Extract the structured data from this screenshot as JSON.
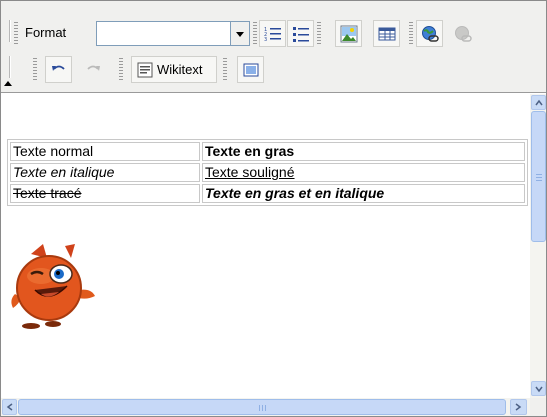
{
  "toolbar": {
    "format_label": "Format",
    "format_select_value": "",
    "wikitext_label": "Wikitext",
    "icons": {
      "ordered_list": "ordered-list-icon",
      "unordered_list": "unordered-list-icon",
      "image": "image-icon",
      "table": "table-icon",
      "link": "link-icon",
      "unlink": "unlink-icon",
      "undo": "undo-icon",
      "redo": "redo-icon",
      "wikitext": "wikitext-icon",
      "fullscreen": "fullscreen-icon"
    }
  },
  "content": {
    "table": {
      "rows": [
        [
          "Texte normal",
          "Texte en gras"
        ],
        [
          "Texte en italique",
          "Texte souligné"
        ],
        [
          "Texte tracé",
          "Texte en gras et en italique"
        ]
      ]
    },
    "image": "orange-mascot-emoticon"
  },
  "colors": {
    "toolbar_bg": "#f0f0ee",
    "scrollbar_thumb": "#c6d8f7",
    "table_border": "#c8c8c8"
  }
}
